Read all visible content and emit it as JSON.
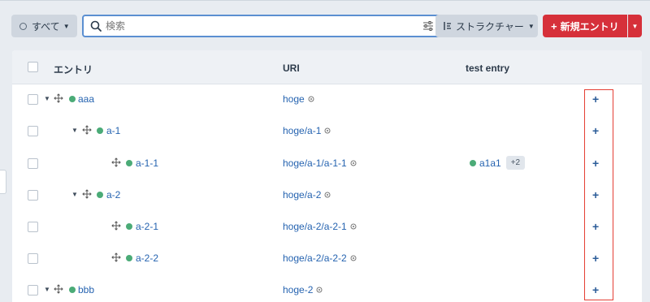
{
  "toolbar": {
    "filter_label": "すべて",
    "search_placeholder": "検索",
    "structure_label": "ストラクチャー",
    "new_entry_label": "新規エントリ"
  },
  "table": {
    "headers": {
      "entry": "エントリ",
      "uri": "URI",
      "test_entry": "test entry"
    },
    "rows": [
      {
        "label": "aaa",
        "uri": "hoge",
        "expandable": true,
        "depth": 0
      },
      {
        "label": "a-1",
        "uri": "hoge/a-1",
        "expandable": true,
        "depth": 1
      },
      {
        "label": "a-1-1",
        "uri": "hoge/a-1/a-1-1",
        "expandable": false,
        "depth": 2,
        "test_entry": {
          "value": "a1a1",
          "more": "+2"
        }
      },
      {
        "label": "a-2",
        "uri": "hoge/a-2",
        "expandable": true,
        "depth": 1
      },
      {
        "label": "a-2-1",
        "uri": "hoge/a-2/a-2-1",
        "expandable": false,
        "depth": 2
      },
      {
        "label": "a-2-2",
        "uri": "hoge/a-2/a-2-2",
        "expandable": false,
        "depth": 2
      },
      {
        "label": "bbb",
        "uri": "hoge-2",
        "expandable": true,
        "depth": 0
      }
    ],
    "add_icon": "plus-icon"
  },
  "colors": {
    "accent": "#d6303a",
    "link": "#2563b0",
    "status_dot": "#4bab77",
    "highlight": "#e53f34"
  }
}
